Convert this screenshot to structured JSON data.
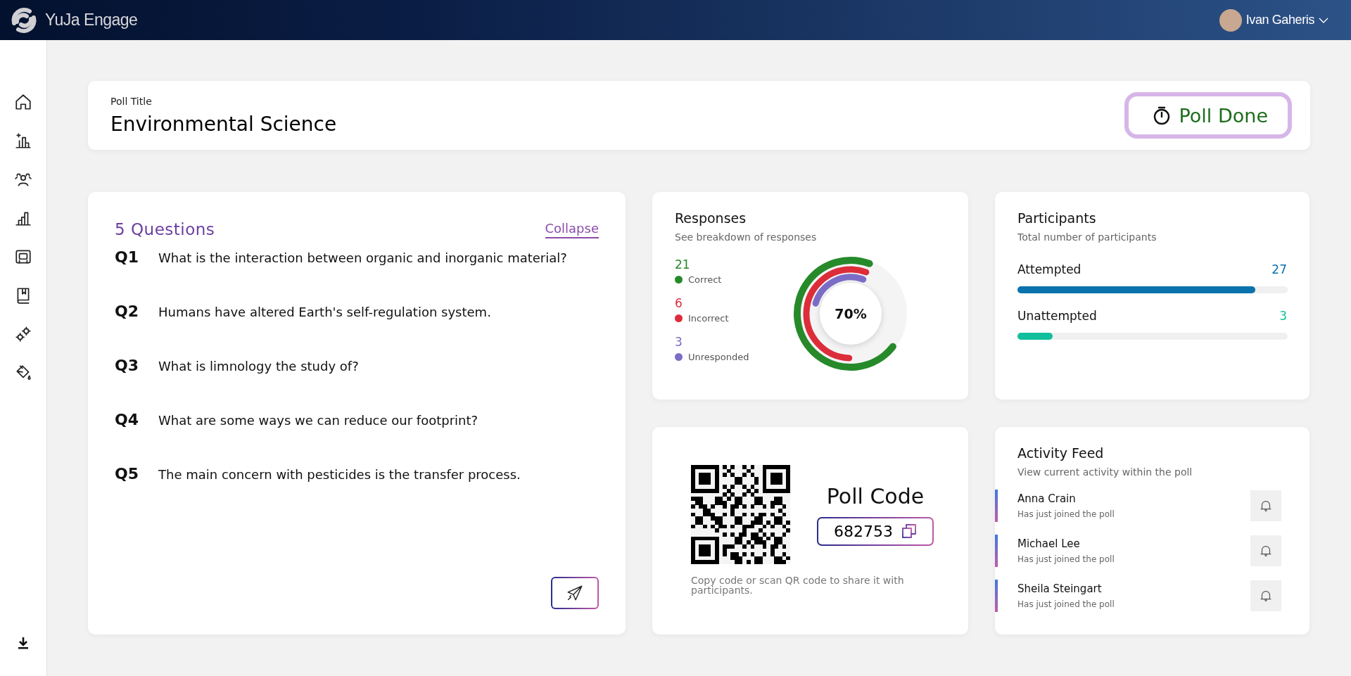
{
  "header": {
    "app_name": "YuJa Engage",
    "user_name": "Ivan Gaheris"
  },
  "poll": {
    "label": "Poll Title",
    "title": "Environmental Science",
    "status": "Poll Done"
  },
  "questions": {
    "count_label": "5 Questions",
    "collapse": "Collapse",
    "items": [
      {
        "number": "Q1",
        "text": "What is the interaction between organic and inorganic material?"
      },
      {
        "number": "Q2",
        "text": "Humans have altered Earth's self-regulation system."
      },
      {
        "number": "Q3",
        "text": "What is limnology the study of?"
      },
      {
        "number": "Q4",
        "text": "What are some ways we can reduce our footprint?"
      },
      {
        "number": "Q5",
        "text": "The main concern with pesticides is the transfer process."
      }
    ]
  },
  "responses": {
    "title": "Responses",
    "subtitle": "See breakdown of responses",
    "center_label": "70%",
    "items": [
      {
        "count": "21",
        "label": "Correct",
        "color": "#268a2a",
        "level": 0.7
      },
      {
        "count": "6",
        "label": "Incorrect",
        "color": "#dc2d3a",
        "level": 0.55
      },
      {
        "count": "3",
        "label": "Unresponded",
        "color": "#7b6cc6",
        "level": 0.26
      }
    ]
  },
  "participants": {
    "title": "Participants",
    "subtitle": "Total number of participants",
    "items": [
      {
        "label": "Attempted",
        "count": "27",
        "color": "#0a72ad",
        "level": 0.88
      },
      {
        "label": "Unattempted",
        "count": "3",
        "color": "#12bf9c",
        "level": 0.13
      }
    ]
  },
  "poll_code": {
    "title": "Poll Code",
    "code": "682753",
    "hint": "Copy code or scan QR code to share it with participants."
  },
  "activity": {
    "title": "Activity Feed",
    "subtitle": "View current activity within the poll",
    "items": [
      {
        "name": "Anna Crain",
        "message": "Has just joined the poll"
      },
      {
        "name": "Michael Lee",
        "message": "Has just joined the poll"
      },
      {
        "name": "Sheila Steingart",
        "message": "Has just joined the poll"
      }
    ]
  }
}
